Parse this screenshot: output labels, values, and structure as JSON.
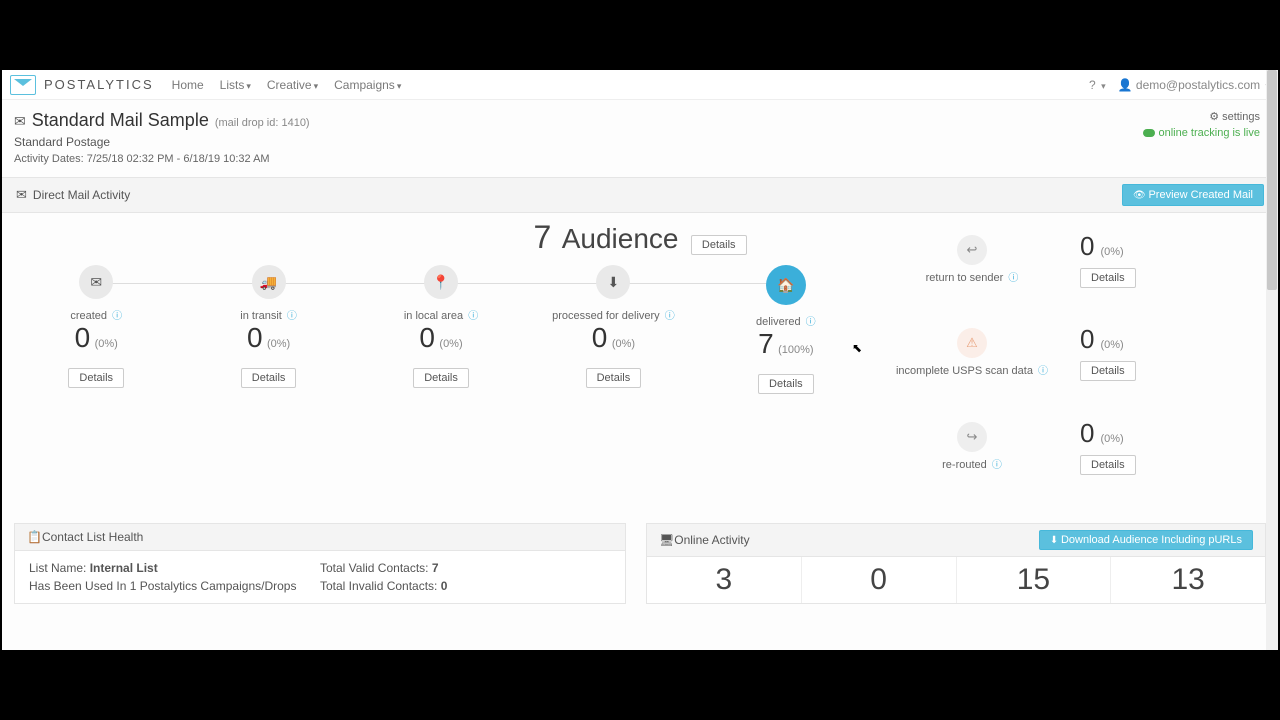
{
  "brand": "POSTALYTICS",
  "nav": {
    "home": "Home",
    "lists": "Lists",
    "creative": "Creative",
    "campaigns": "Campaigns"
  },
  "user": {
    "email": "demo@postalytics.com",
    "help": "?"
  },
  "page": {
    "title": "Standard Mail Sample",
    "drop_id": "(mail drop id: 1410)",
    "postage": "Standard Postage",
    "dates": "Activity Dates: 7/25/18 02:32 PM - 6/18/19 10:32 AM"
  },
  "settings": {
    "label": "settings",
    "tracking": "online tracking is live"
  },
  "direct_mail": {
    "header": "Direct Mail Activity",
    "preview_btn": "Preview Created Mail",
    "audience_count": "7",
    "audience_label": "Audience",
    "details": "Details"
  },
  "stages": [
    {
      "icon": "✉",
      "label": "created",
      "count": "0",
      "pct": "(0%)",
      "active": false
    },
    {
      "icon": "🚚",
      "label": "in transit",
      "count": "0",
      "pct": "(0%)",
      "active": false
    },
    {
      "icon": "📍",
      "label": "in local area",
      "count": "0",
      "pct": "(0%)",
      "active": false
    },
    {
      "icon": "⬇",
      "label": "processed for delivery",
      "count": "0",
      "pct": "(0%)",
      "active": false
    },
    {
      "icon": "🏠",
      "label": "delivered",
      "count": "7",
      "pct": "(100%)",
      "active": true
    }
  ],
  "side": [
    {
      "icon": "↩",
      "label": "return to sender",
      "count": "0",
      "pct": "(0%)",
      "class": ""
    },
    {
      "icon": "⚠",
      "label": "incomplete USPS scan data",
      "count": "0",
      "pct": "(0%)",
      "class": "warn"
    },
    {
      "icon": "↪",
      "label": "re-routed",
      "count": "0",
      "pct": "(0%)",
      "class": ""
    }
  ],
  "contact": {
    "header": "Contact List Health",
    "list_label": "List Name: ",
    "list_name": "Internal List",
    "usage": "Has Been Used In 1 Postalytics Campaigns/Drops",
    "valid_label": "Total Valid Contacts: ",
    "valid_count": "7",
    "invalid_label": "Total Invalid Contacts: ",
    "invalid_count": "0"
  },
  "online": {
    "header": "Online Activity",
    "download_btn": "Download Audience Including pURLs",
    "stats": [
      "3",
      "0",
      "15",
      "13"
    ]
  }
}
